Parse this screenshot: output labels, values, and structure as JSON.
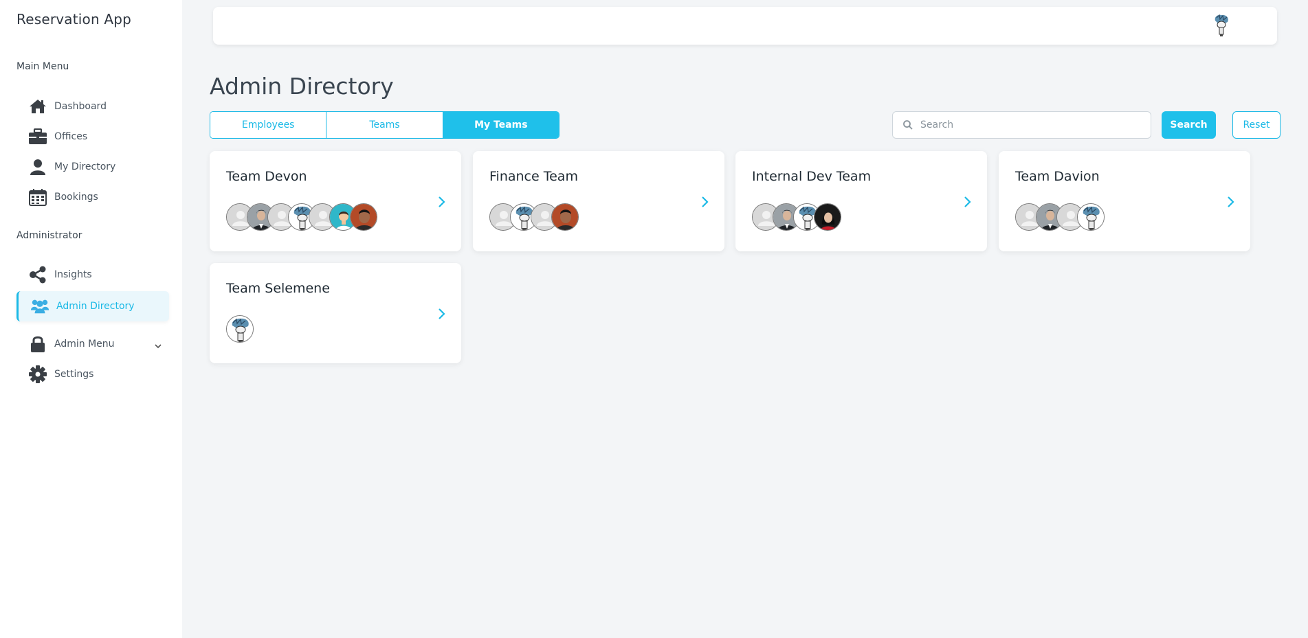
{
  "app": {
    "title": "Reservation App"
  },
  "sidebar": {
    "main_menu_label": "Main Menu",
    "admin_label": "Administrator",
    "main_items": [
      {
        "label": "Dashboard",
        "icon": "home-icon"
      },
      {
        "label": "Offices",
        "icon": "briefcase-icon"
      },
      {
        "label": "My Directory",
        "icon": "user-icon"
      },
      {
        "label": "Bookings",
        "icon": "calendar-icon"
      }
    ],
    "admin_items": [
      {
        "label": "Insights",
        "icon": "share-icon"
      },
      {
        "label": "Admin Directory",
        "icon": "users-icon",
        "active": true
      },
      {
        "label": "Admin Menu",
        "icon": "lock-icon"
      },
      {
        "label": "Settings",
        "icon": "gear-icon"
      }
    ]
  },
  "page": {
    "title": "Admin Directory"
  },
  "tabs": [
    {
      "label": "Employees"
    },
    {
      "label": "Teams"
    },
    {
      "label": "My Teams",
      "active": true
    }
  ],
  "search": {
    "placeholder": "Search",
    "value": "",
    "button_label": "Search",
    "reset_label": "Reset"
  },
  "teams": [
    {
      "name": "Team Devon",
      "avatars": [
        "placeholder",
        "man-suit",
        "placeholder",
        "cartoon",
        "placeholder",
        "teal-avatar",
        "man-dark"
      ]
    },
    {
      "name": "Finance Team",
      "avatars": [
        "placeholder",
        "cartoon",
        "placeholder",
        "man-dark"
      ]
    },
    {
      "name": "Internal Dev Team",
      "avatars": [
        "placeholder",
        "man-suit",
        "cartoon",
        "woman-red"
      ]
    },
    {
      "name": "Team Davion",
      "avatars": [
        "placeholder",
        "man-suit",
        "placeholder",
        "cartoon"
      ]
    },
    {
      "name": "Team Selemene",
      "avatars": [
        "cartoon"
      ]
    }
  ],
  "colors": {
    "accent": "#1fc0ea",
    "sidebar_bg": "#ffffff",
    "page_bg": "#f3f5f7",
    "icon": "#3a3f45"
  }
}
